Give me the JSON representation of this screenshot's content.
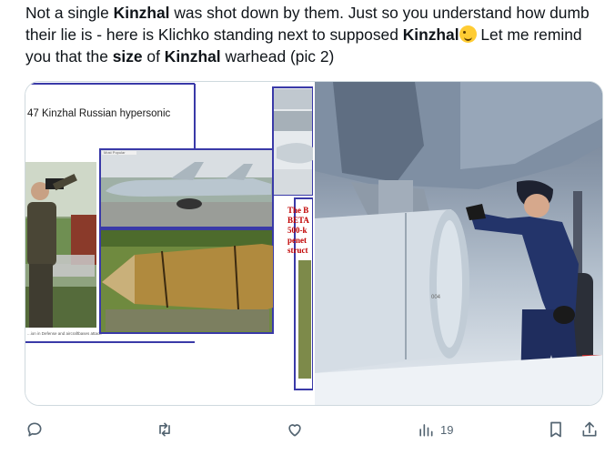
{
  "tweet": {
    "segments": [
      {
        "t": "Not a single ",
        "b": false
      },
      {
        "t": "Kinzhal",
        "b": true
      },
      {
        "t": " was shot down by them. Just so you understand how dumb their lie is - here is Klichko standing next to supposed ",
        "b": false
      },
      {
        "t": "Kinzhal",
        "b": true
      },
      {
        "emoji": "zany-face-emoji"
      },
      {
        "t": " Let me remind you that the ",
        "b": false
      },
      {
        "t": "size",
        "b": true
      },
      {
        "t": " of ",
        "b": false
      },
      {
        "t": "Kinzhal",
        "b": true
      },
      {
        "t": " warhead (pic 2)",
        "b": false
      }
    ]
  },
  "media": {
    "pic1": {
      "caption": "47 Kinzhal Russian hypersonic",
      "small_label": "Most Popular",
      "red_text_lines": [
        "The B",
        "BETA",
        "500-k",
        "penet",
        "struct"
      ],
      "footer_caption": "...ion in Defense and aircraftbases attack"
    },
    "pic2": {
      "panel_mark": "004"
    }
  },
  "actions": {
    "reply_icon": "reply-icon",
    "retweet_icon": "retweet-icon",
    "like_icon": "heart-icon",
    "views_icon": "views-chart-icon",
    "views_count": "19",
    "bookmark_icon": "bookmark-icon",
    "share_icon": "share-icon"
  },
  "colors": {
    "text": "#0f1419",
    "muted": "#536471",
    "border": "#cfd9de",
    "collage_frame": "#3a3aa8",
    "headline_red": "#c00000"
  }
}
